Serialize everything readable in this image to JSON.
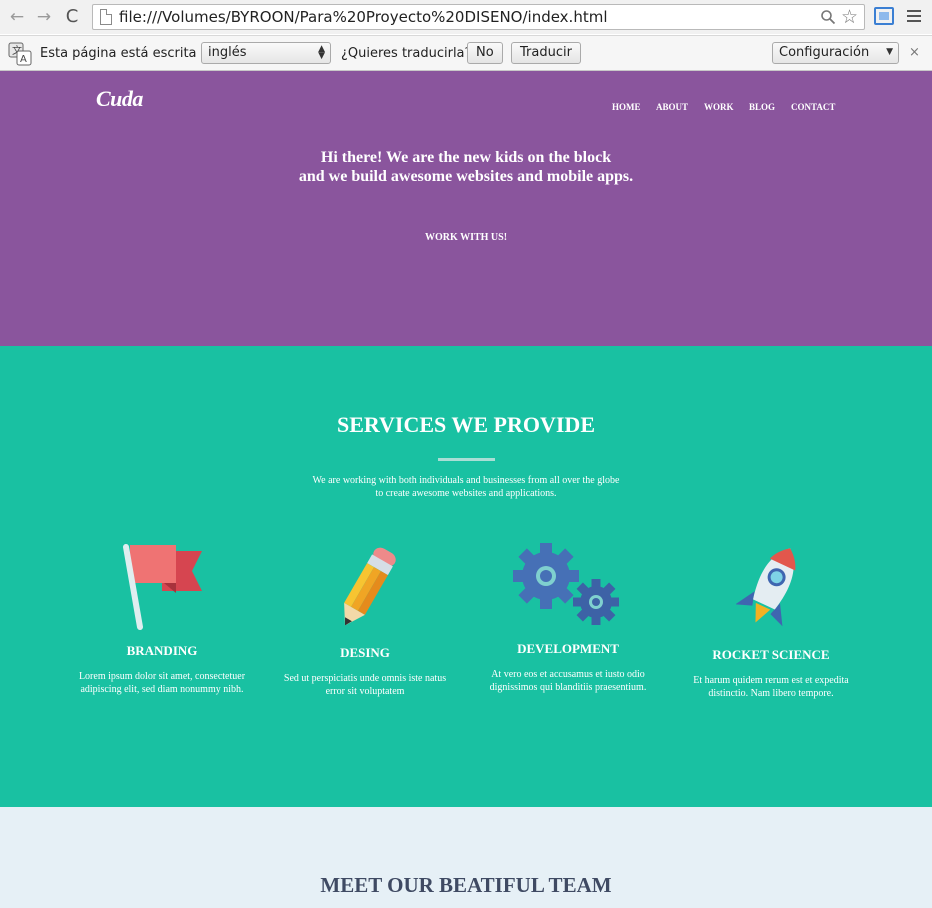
{
  "browser": {
    "url": "file:///Volumes/BYROON/Para%20Proyecto%20DISENO/index.html",
    "back_icon": "←",
    "forward_icon": "→",
    "reload_icon": "C",
    "star_icon": "☆"
  },
  "translate_bar": {
    "prefix": "Esta página está escrita en",
    "language": "inglés",
    "question": "¿Quieres traducirla?",
    "no_label": "No",
    "translate_label": "Traducir",
    "settings_label": "Configuración",
    "close_icon": "×"
  },
  "site": {
    "logo": "Cuda",
    "nav": [
      "HOME",
      "ABOUT",
      "WORK",
      "BLOG",
      "CONTACT"
    ],
    "hero_line1": "Hi there! We are the new kids on the block",
    "hero_line2": "and we build awesome websites and mobile apps.",
    "cta": "WORK WITH US!",
    "services_title": "SERVICES WE PROVIDE",
    "services_sub1": "We are working with both individuals and businesses from all over the globe",
    "services_sub2": "to create awesome websites and applications.",
    "services": [
      {
        "name": "BRANDING",
        "icon": "flag-icon",
        "text": "Lorem ipsum dolor sit amet, consectetuer adipiscing elit, sed diam nonummy nibh."
      },
      {
        "name": "DESING",
        "icon": "pencil-icon",
        "text": "Sed ut perspiciatis unde omnis iste natus error sit voluptatem"
      },
      {
        "name": "DEVELOPMENT",
        "icon": "gears-icon",
        "text": "At vero eos et accusamus et iusto odio dignissimos qui blanditiis praesentium."
      },
      {
        "name": "ROCKET SCIENCE",
        "icon": "rocket-icon",
        "text": "Et harum quidem rerum est et expedita distinctio. Nam libero tempore."
      }
    ],
    "team_title": "MEET OUR BEATIFUL TEAM"
  },
  "colors": {
    "hero_bg": "#8a559d",
    "services_bg": "#19c1a2",
    "team_bg": "#e6f0f6"
  }
}
